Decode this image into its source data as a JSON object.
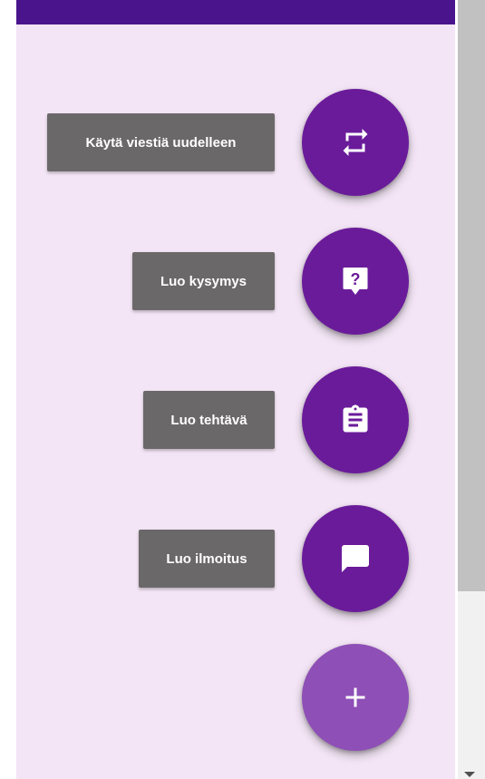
{
  "speed_dial": {
    "actions": [
      {
        "label": "Käytä viestiä uudelleen",
        "icon": "repeat-icon"
      },
      {
        "label": "Luo kysymys",
        "icon": "question-icon"
      },
      {
        "label": "Luo tehtävä",
        "icon": "clipboard-icon"
      },
      {
        "label": "Luo ilmoitus",
        "icon": "chat-icon"
      }
    ],
    "main_button": {
      "icon": "plus-icon"
    }
  },
  "colors": {
    "header": "#4a148c",
    "panel_background": "#f3e5f5",
    "fab": "#6a1b9a",
    "fab_main": "#8e4fb6",
    "label_background": "#6b6869",
    "label_text": "#ffffff",
    "scrollbar_thumb": "#c1c1c1"
  }
}
